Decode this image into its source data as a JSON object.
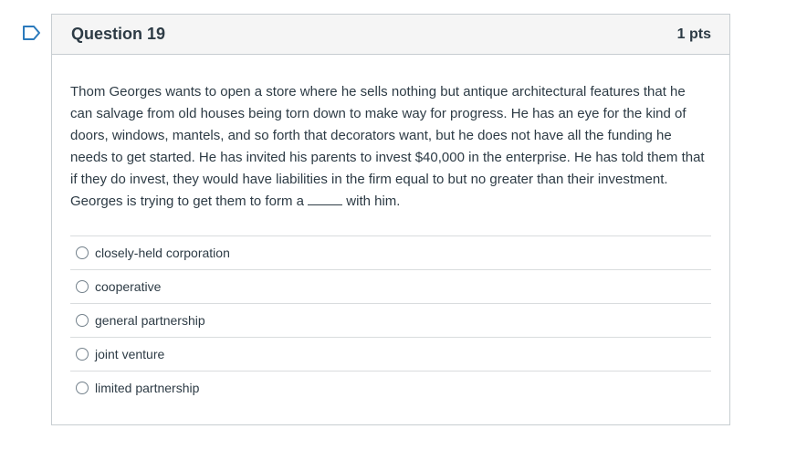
{
  "question": {
    "title": "Question 19",
    "points": "1 pts",
    "text_before": "Thom Georges wants to open a store where he sells nothing but antique architectural features that he can salvage from old houses being torn down to make way for progress. He has an eye for the kind of doors, windows, mantels, and so forth that decorators want, but he does not have all the funding he needs to get started. He has invited his parents to invest $40,000 in the enterprise. He has told them that if they do invest, they would have liabilities in the firm equal to but no greater than their investment. Georges is trying to get them to form a",
    "text_after": " with him."
  },
  "answers": [
    {
      "label": "closely-held corporation"
    },
    {
      "label": "cooperative"
    },
    {
      "label": "general partnership"
    },
    {
      "label": "joint venture"
    },
    {
      "label": "limited partnership"
    }
  ],
  "colors": {
    "flag": "#2b7abc",
    "text": "#2d3b45",
    "border": "#c7cdd1",
    "header_bg": "#f5f5f5"
  },
  "icons": {
    "flag": "flag-question-icon"
  }
}
